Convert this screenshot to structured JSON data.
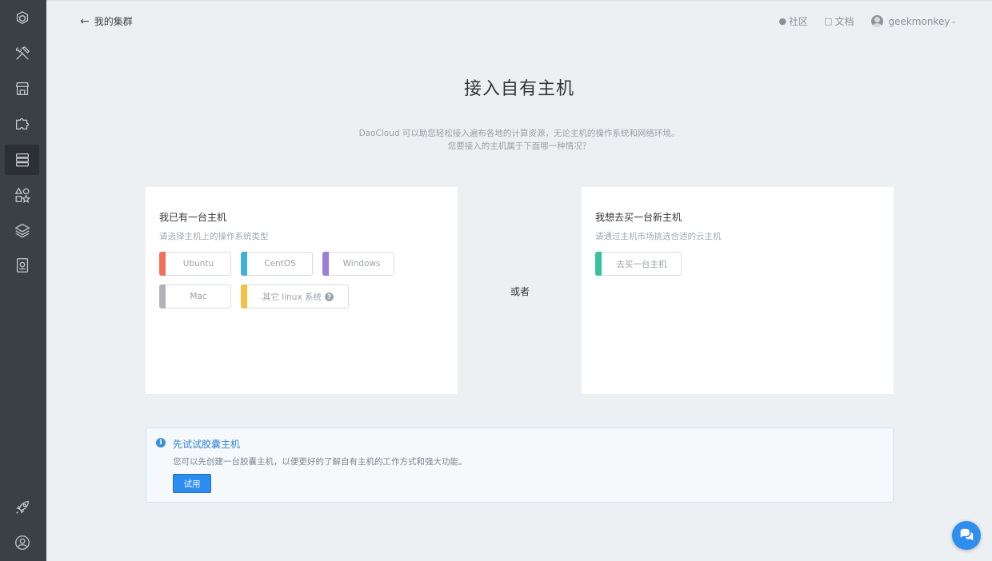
{
  "sidebar": {
    "items": [
      {
        "name": "logo-icon",
        "icon": "logo"
      },
      {
        "name": "tools-icon",
        "icon": "hammer-wrench"
      },
      {
        "name": "store-icon",
        "icon": "storefront"
      },
      {
        "name": "puzzle-icon",
        "icon": "puzzle"
      },
      {
        "name": "server-icon",
        "icon": "server-stack",
        "active": true
      },
      {
        "name": "shapes-icon",
        "icon": "shapes"
      },
      {
        "name": "layers-icon",
        "icon": "layers"
      },
      {
        "name": "monitor-icon",
        "icon": "eye-box"
      },
      {
        "name": "rocket-icon",
        "icon": "rocket"
      },
      {
        "name": "user-icon",
        "icon": "user-circle"
      }
    ]
  },
  "header": {
    "back_label": "我的集群",
    "community_label": "社区",
    "docs_label": "文档",
    "username": "geekmonkey"
  },
  "page": {
    "title": "接入自有主机",
    "subtitle_line1": "DaoCloud 可以助您轻松接入遍布各地的计算资源，无论主机的操作系统和网络环境。",
    "subtitle_line2": "您要接入的主机属于下面哪一种情况？",
    "or_label": "或者"
  },
  "left_card": {
    "title": "我已有一台主机",
    "desc": "请选择主机上的操作系统类型",
    "os_options": [
      {
        "label": "Ubuntu",
        "color": "#f2705a"
      },
      {
        "label": "CentOS",
        "color": "#3fb1d6"
      },
      {
        "label": "Windows",
        "color": "#9b7fd6"
      },
      {
        "label": "Mac",
        "color": "#b0b4ba"
      },
      {
        "label": "其它 linux 系统",
        "color": "#f4bf44"
      }
    ]
  },
  "right_card": {
    "title": "我想去买一台新主机",
    "desc": "请通过主机市场挑选合适的云主机",
    "buy_label": "去买一台主机",
    "buy_color": "#36c29b"
  },
  "notice": {
    "title": "先试试胶囊主机",
    "desc": "您可以先创建一台胶囊主机，以便更好的了解自有主机的工作方式和强大功能。",
    "button_label": "试用"
  },
  "colors": {
    "sidebar_bg": "#3b4045",
    "page_bg": "#edf0f2",
    "accent": "#2d8cf0"
  }
}
